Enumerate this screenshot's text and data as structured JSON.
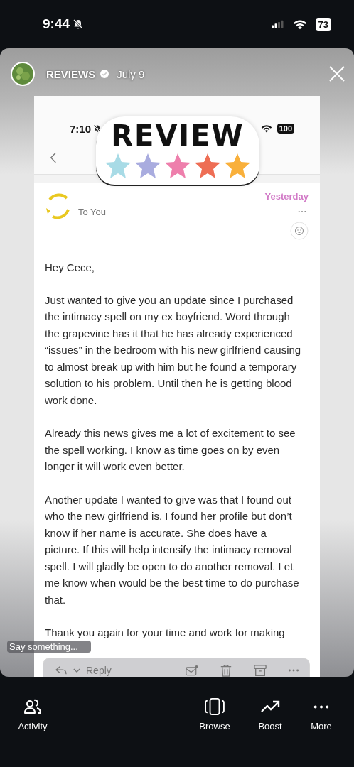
{
  "status_bar": {
    "time": "9:44",
    "battery": "73"
  },
  "story": {
    "account": "REVIEWS",
    "verified": true,
    "date": "July 9"
  },
  "sticker": {
    "title": "REVIEW"
  },
  "screenshot": {
    "status_bar": {
      "time": "7:10",
      "battery": "100"
    },
    "email": {
      "recipient": "To You",
      "date": "Yesterday",
      "greeting": "Hey Cece,",
      "paragraphs": [
        "Just wanted to give you an update since I purchased the intimacy spell on my ex boyfriend. Word through the grapevine has it that he has already experienced “issues” in the bedroom with his new girlfriend causing to almost break up with him but he found a temporary solution to his problem. Until then he is getting blood work done.",
        "Already this news gives me a lot of excitement to see the spell working. I know as time goes on by even longer it will work even better.",
        "Another update I wanted to give was that I found out who the new girlfriend is. I found her profile but don’t know if her name is accurate. She does have a picture. If this will help intensify the intimacy removal spell. I will gladly be open to do another removal. Let me know when would be the best time to do purchase that.",
        "Thank you again for your time and work for making"
      ]
    },
    "reply_bar": {
      "label": "Reply"
    }
  },
  "reply_field": {
    "placeholder": "Say something..."
  },
  "nav": [
    {
      "kind": "activity",
      "label": "Activity"
    },
    {
      "kind": "browse",
      "label": "Browse"
    },
    {
      "kind": "boost",
      "label": "Boost"
    },
    {
      "kind": "more",
      "label": "More"
    }
  ]
}
